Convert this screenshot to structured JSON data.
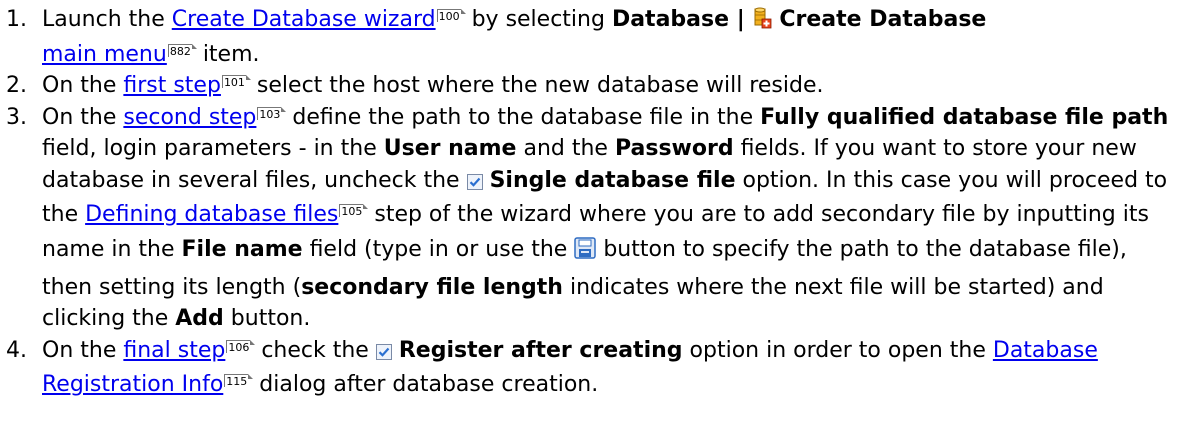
{
  "items": [
    {
      "num": "1.",
      "t1": "Launch the ",
      "link1": "Create Database wizard",
      "ref1": "100",
      "t2": " by selecting ",
      "b1": "Database | ",
      "b2": "Create Database",
      "link2": "main menu",
      "ref2": "882",
      "t3": " item."
    },
    {
      "num": "2.",
      "t1": "On the ",
      "link1": "first step",
      "ref1": "101",
      "t2": " select the host where the new database will reside."
    },
    {
      "num": "3.",
      "t1": "On the ",
      "link1": "second step",
      "ref1": "103",
      "t2": " define the path to the database file in the ",
      "b1": "Fully qualified database file path",
      "t3": " field, login parameters - in the ",
      "b2": "User name",
      "t4": " and the ",
      "b3": "Password",
      "t5": " fields. If you want to store your new database in several files, uncheck the ",
      "b4": "Single database file",
      "t6": " option. In this case you will proceed to the ",
      "link2": "Defining database files",
      "ref2": "105",
      "t7": " step of the wizard where you are to add secondary file by inputting its name in the ",
      "b5": "File name",
      "t8": " field (type in or use the ",
      "t9": " button to specify the path to the database file), then setting its length (",
      "b6": "secondary file length",
      "t10": " indicates where the next file will be started) and clicking the ",
      "b7": "Add",
      "t11": " button."
    },
    {
      "num": "4.",
      "t1": "On the ",
      "link1": "final step",
      "ref1": "106",
      "t2": " check the ",
      "b1": "Register after creating",
      "t3": " option in order to open the ",
      "link2": "Database Registration Info",
      "ref2": "115",
      "t4": " dialog after database creation."
    }
  ],
  "icons": {
    "database": "create-database-icon",
    "checkbox": "checked-checkbox-icon",
    "save": "save-file-icon"
  },
  "colors": {
    "link": "#0000ee",
    "text": "#000000",
    "checkbox_check": "#2a6fd0",
    "save_icon": "#2f6cc2"
  }
}
